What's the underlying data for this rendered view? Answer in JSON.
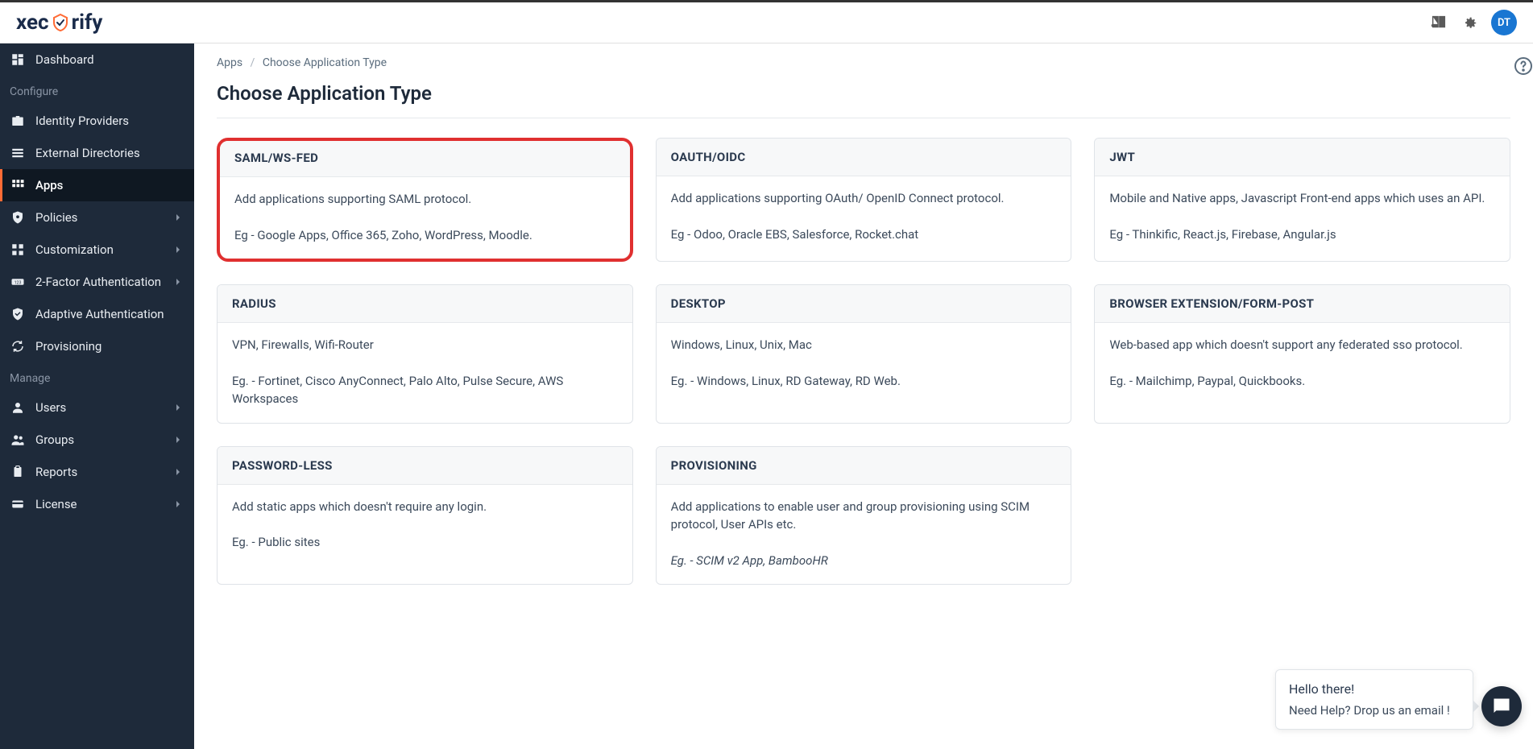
{
  "header": {
    "logo_text_pre": "xec",
    "logo_text_post": "rify",
    "avatar_initials": "DT"
  },
  "sidebar": {
    "items": [
      {
        "label": "Dashboard",
        "section": null,
        "has_chevron": false,
        "active": false,
        "icon": "dashboard"
      },
      {
        "label": "Configure",
        "section": true
      },
      {
        "label": "Identity Providers",
        "section": null,
        "has_chevron": false,
        "active": false,
        "icon": "briefcase"
      },
      {
        "label": "External Directories",
        "section": null,
        "has_chevron": false,
        "active": false,
        "icon": "list"
      },
      {
        "label": "Apps",
        "section": null,
        "has_chevron": false,
        "active": true,
        "icon": "grid"
      },
      {
        "label": "Policies",
        "section": null,
        "has_chevron": true,
        "active": false,
        "icon": "shield-cog"
      },
      {
        "label": "Customization",
        "section": null,
        "has_chevron": true,
        "active": false,
        "icon": "puzzle"
      },
      {
        "label": "2-Factor Authentication",
        "section": null,
        "has_chevron": true,
        "active": false,
        "icon": "badge-123"
      },
      {
        "label": "Adaptive Authentication",
        "section": null,
        "has_chevron": false,
        "active": false,
        "icon": "shield-check"
      },
      {
        "label": "Provisioning",
        "section": null,
        "has_chevron": false,
        "active": false,
        "icon": "sync"
      },
      {
        "label": "Manage",
        "section": true
      },
      {
        "label": "Users",
        "section": null,
        "has_chevron": true,
        "active": false,
        "icon": "user"
      },
      {
        "label": "Groups",
        "section": null,
        "has_chevron": true,
        "active": false,
        "icon": "users"
      },
      {
        "label": "Reports",
        "section": null,
        "has_chevron": true,
        "active": false,
        "icon": "clipboard"
      },
      {
        "label": "License",
        "section": null,
        "has_chevron": true,
        "active": false,
        "icon": "card"
      }
    ]
  },
  "breadcrumb": {
    "parent": "Apps",
    "current": "Choose Application Type"
  },
  "page": {
    "title": "Choose Application Type"
  },
  "cards": [
    {
      "title": "SAML/WS-FED",
      "desc": "Add applications supporting SAML protocol.",
      "example": "Eg - Google Apps, Office 365, Zoho, WordPress, Moodle.",
      "highlighted": true
    },
    {
      "title": "OAUTH/OIDC",
      "desc": "Add applications supporting OAuth/ OpenID Connect protocol.",
      "example": "Eg - Odoo, Oracle EBS, Salesforce, Rocket.chat"
    },
    {
      "title": "JWT",
      "desc": "Mobile and Native apps, Javascript Front-end apps which uses an API.",
      "example": "Eg - Thinkific, React.js, Firebase, Angular.js"
    },
    {
      "title": "RADIUS",
      "desc": "VPN, Firewalls, Wifi-Router",
      "example": "Eg. - Fortinet, Cisco AnyConnect, Palo Alto, Pulse Secure, AWS Workspaces"
    },
    {
      "title": "DESKTOP",
      "desc": "Windows, Linux, Unix, Mac",
      "example": "Eg. - Windows, Linux, RD Gateway, RD Web."
    },
    {
      "title": "BROWSER EXTENSION/FORM-POST",
      "desc": "Web-based app which doesn't support any federated sso protocol.",
      "example": "Eg. - Mailchimp, Paypal, Quickbooks."
    },
    {
      "title": "PASSWORD-LESS",
      "desc": "Add static apps which doesn't require any login.",
      "example": "Eg. - Public sites"
    },
    {
      "title": "PROVISIONING",
      "desc": "Add applications to enable user and group provisioning using SCIM protocol, User APIs etc.",
      "example": "Eg. - SCIM v2 App, BambooHR",
      "example_italic": true
    }
  ],
  "help": {
    "line1": "Hello there!",
    "line2": "Need Help? Drop us an email !"
  }
}
